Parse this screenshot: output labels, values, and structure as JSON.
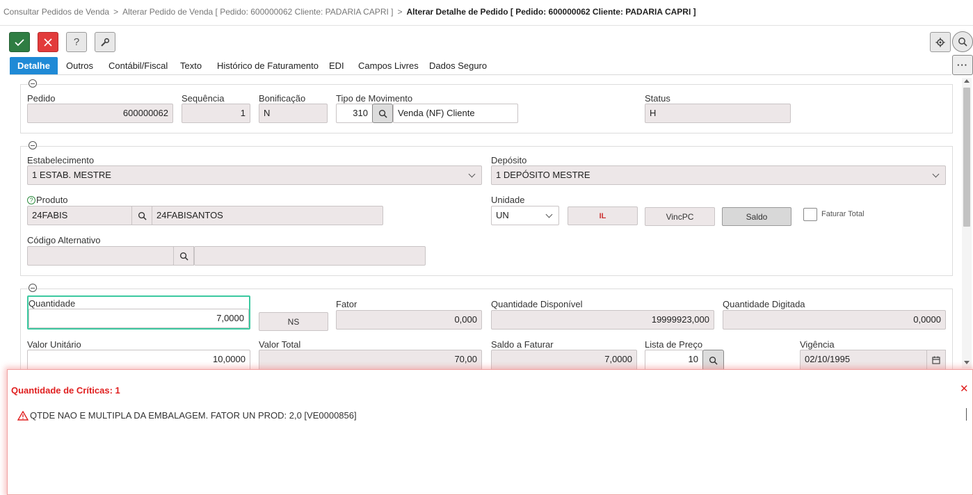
{
  "breadcrumb": {
    "item1": "Consultar Pedidos de Venda",
    "item2": "Alterar Pedido de Venda [ Pedido: 600000062 Cliente: PADARIA CAPRI ]",
    "current": "Alterar Detalhe de Pedido [ Pedido: 600000062 Cliente: PADARIA CAPRI ]",
    "separator": ">"
  },
  "toolbar": {
    "confirm_icon": "check-icon",
    "cancel_icon": "close-icon",
    "help_label": "?",
    "tools_icon": "wrench-icon"
  },
  "tabs": [
    {
      "label": "Detalhe",
      "active": true
    },
    {
      "label": "Outros"
    },
    {
      "label": "Contábil/Fiscal"
    },
    {
      "label": "Texto"
    },
    {
      "label": "Histórico de Faturamento"
    },
    {
      "label": "EDI"
    },
    {
      "label": "Campos Livres"
    },
    {
      "label": "Dados Seguro"
    }
  ],
  "more_label": "···",
  "section1": {
    "pedido_label": "Pedido",
    "pedido_value": "600000062",
    "sequencia_label": "Sequência",
    "sequencia_value": "1",
    "bonificacao_label": "Bonificação",
    "bonificacao_value": "N",
    "tipo_mov_label": "Tipo de Movimento",
    "tipo_mov_code": "310",
    "tipo_mov_desc": "Venda (NF) Cliente",
    "status_label": "Status",
    "status_value": "H"
  },
  "section2": {
    "estab_label": "Estabelecimento",
    "estab_value": "1 ESTAB. MESTRE",
    "deposito_label": "Depósito",
    "deposito_value": "1 DEPÓSITO MESTRE",
    "produto_help": "?",
    "produto_label": "Produto",
    "produto_code": "24FABIS",
    "produto_desc": "24FABISANTOS",
    "unidade_label": "Unidade",
    "unidade_value": "UN",
    "il_button": "IL",
    "vincpc_button": "VincPC",
    "saldo_button": "Saldo",
    "faturar_total_label": "Faturar Total",
    "codigo_alt_label": "Código Alternativo",
    "codigo_alt_value": "",
    "codigo_alt_desc": ""
  },
  "section3": {
    "quantidade_label": "Quantidade",
    "quantidade_value": "7,0000",
    "ns_button": "NS",
    "fator_label": "Fator",
    "fator_value": "0,000",
    "qtd_disp_label": "Quantidade Disponível",
    "qtd_disp_value": "19999923,000",
    "qtd_dig_label": "Quantidade Digitada",
    "qtd_dig_value": "0,0000",
    "valor_unit_label": "Valor Unitário",
    "valor_unit_value": "10,0000",
    "valor_total_label": "Valor Total",
    "valor_total_value": "70,00",
    "saldo_fat_label": "Saldo a Faturar",
    "saldo_fat_value": "7,0000",
    "lista_preco_label": "Lista de Preço",
    "lista_preco_value": "10",
    "vigencia_label": "Vigência",
    "vigencia_value": "02/10/1995"
  },
  "critics": {
    "title": "Quantidade de Críticas: 1",
    "message": "QTDE NAO E MULTIPLA DA EMBALAGEM. FATOR UN PROD: 2,0 [VE0000856]",
    "close_label": "✕"
  },
  "colors": {
    "accent": "#1f8ad6",
    "confirm": "#2f7d43",
    "cancel": "#e23b3b",
    "error": "#e02020",
    "focus": "#3cc9a0",
    "field_bg": "#ede7e8"
  }
}
